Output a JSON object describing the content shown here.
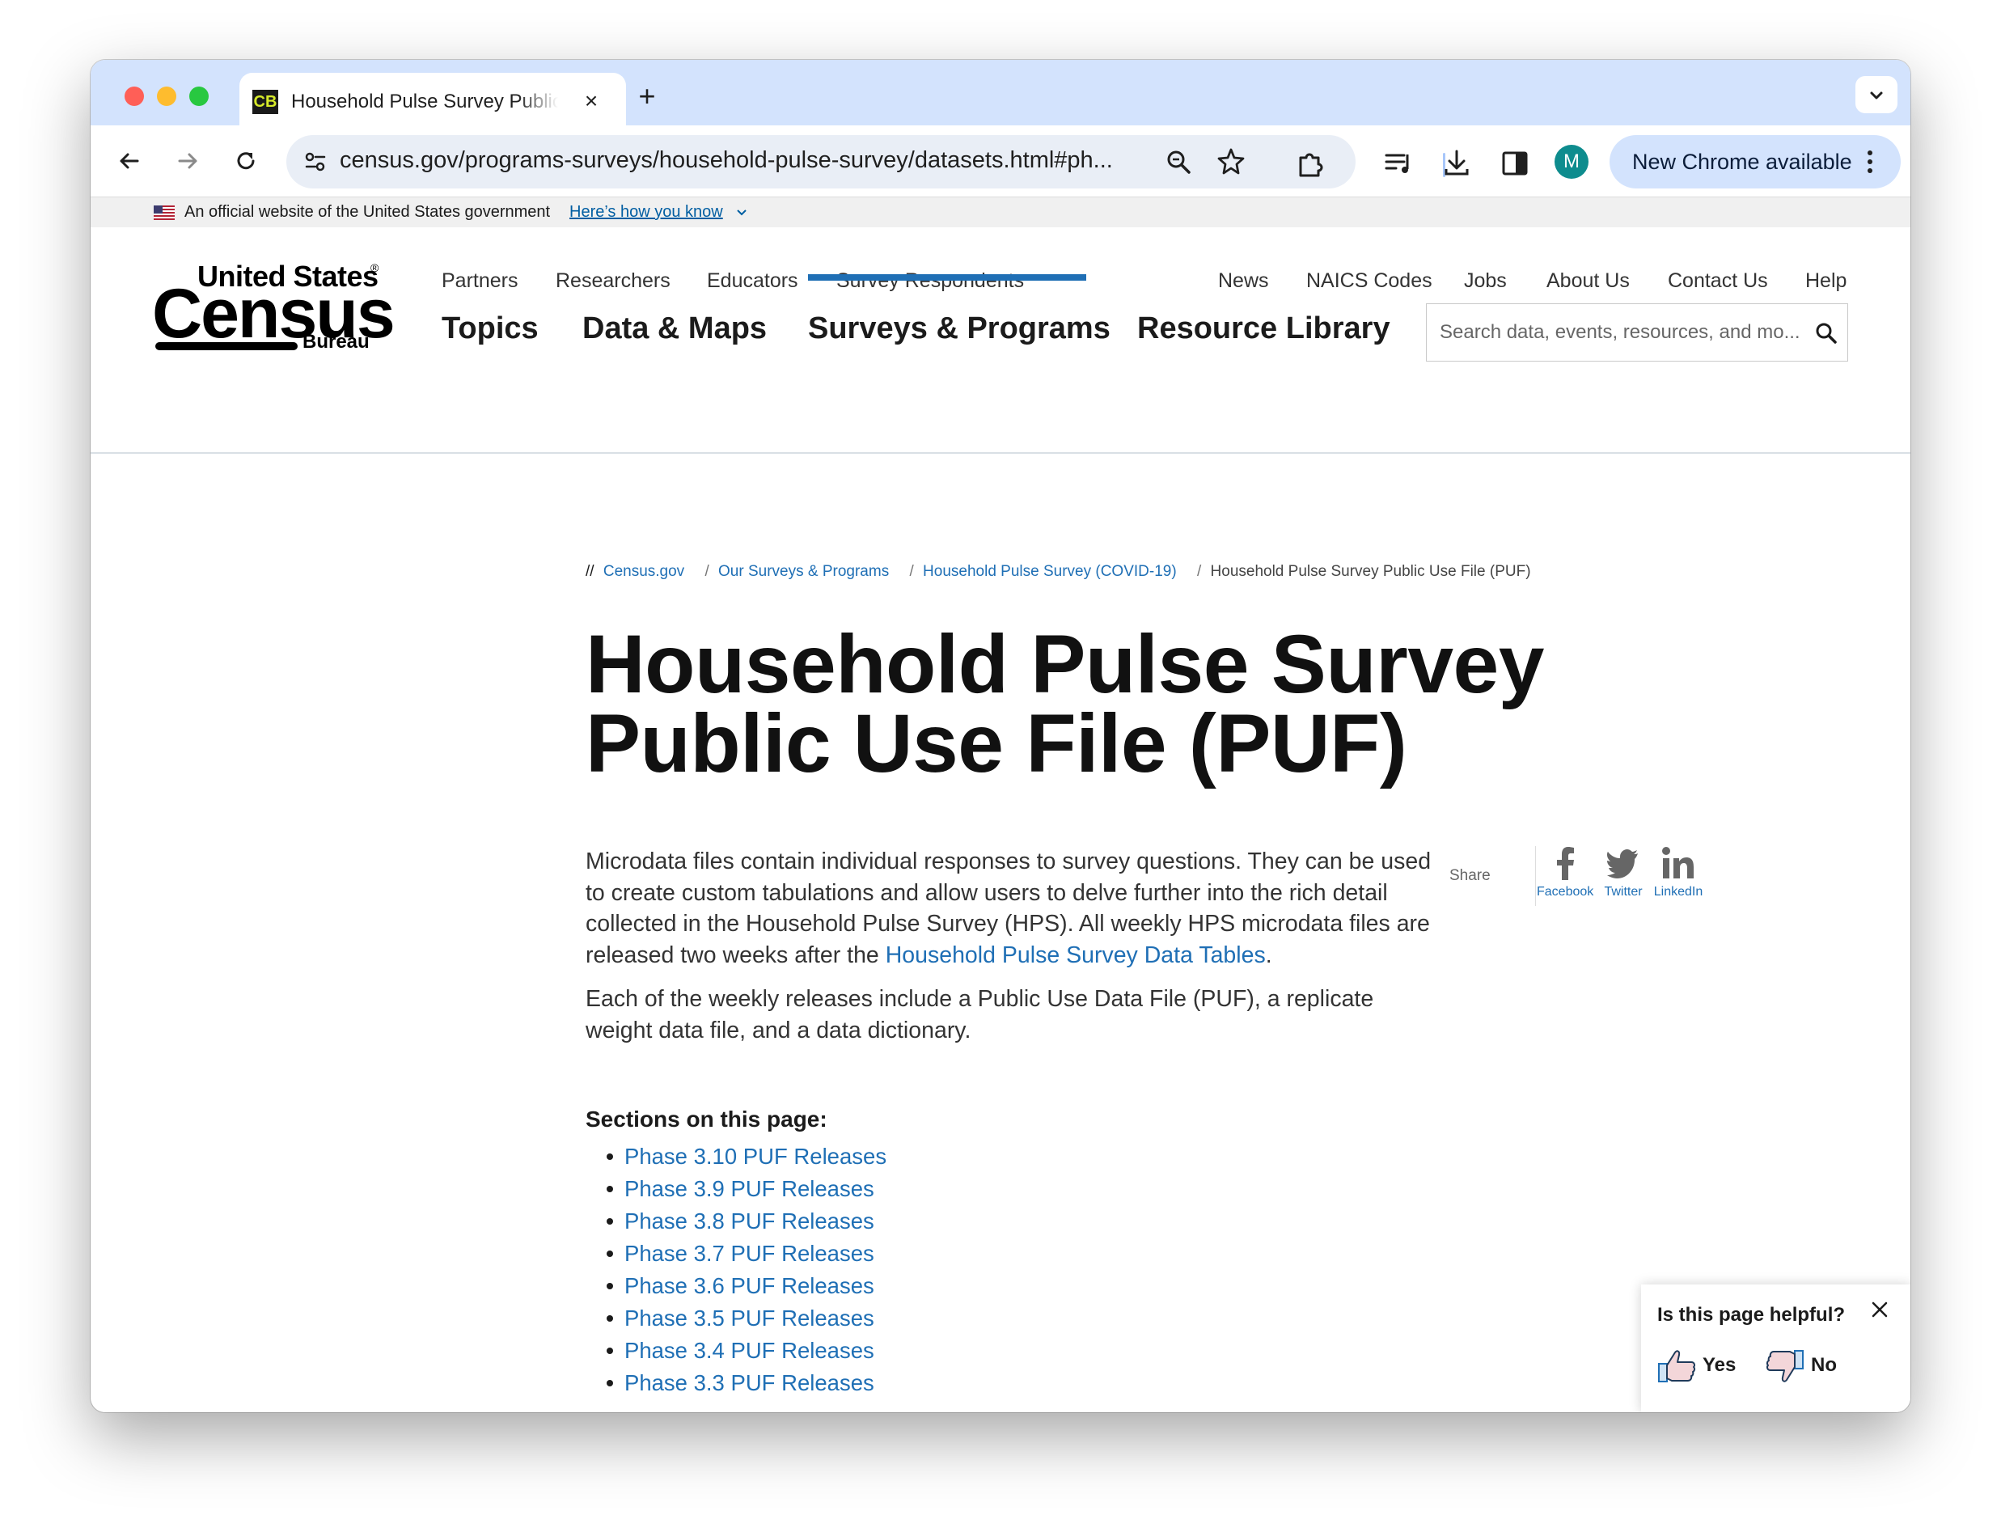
{
  "browser": {
    "tab_title": "Household Pulse Survey Public Use File (PUF)",
    "tab_favicon_text": "CB",
    "url": "census.gov/programs-surveys/household-pulse-survey/datasets.html#ph...",
    "profile_initial": "M",
    "update_button_label": "New Chrome available"
  },
  "gov_banner": {
    "text": "An official website of the United States government",
    "link": "Here’s how you know"
  },
  "logo": {
    "line1": "United States",
    "line2": "Census",
    "line3": "Bureau",
    "reg": "®"
  },
  "utility_nav": {
    "left": [
      "Partners",
      "Researchers",
      "Educators",
      "Survey Respondents"
    ],
    "right": [
      "News",
      "NAICS Codes",
      "Jobs",
      "About Us",
      "Contact Us",
      "Help"
    ]
  },
  "main_nav": {
    "items": [
      "Topics",
      "Data & Maps",
      "Surveys & Programs",
      "Resource Library"
    ],
    "active": "Surveys & Programs"
  },
  "search": {
    "placeholder": "Search data, events, resources, and mo..."
  },
  "breadcrumb": {
    "prefix": "//",
    "links": [
      "Census.gov",
      "Our Surveys & Programs",
      "Household Pulse Survey (COVID-19)"
    ],
    "current": "Household Pulse Survey Public Use File (PUF)"
  },
  "page": {
    "title": "Household Pulse Survey Public Use File (PUF)",
    "intro_before_link": "Microdata files contain individual responses to survey questions. They can be used to create custom tabulations and allow users to delve further into the rich detail collected in the Household Pulse Survey (HPS). All weekly HPS microdata files are released two weeks after the ",
    "intro_link": "Household Pulse Survey Data Tables",
    "intro_after_link": ".",
    "paragraph2": "Each of the weekly releases include a Public Use Data File (PUF), a replicate weight data file, and a data dictionary.",
    "sections_heading": "Sections on this page:",
    "sections": [
      "Phase 3.10 PUF Releases",
      "Phase 3.9 PUF Releases",
      "Phase 3.8 PUF Releases",
      "Phase 3.7 PUF Releases",
      "Phase 3.6 PUF Releases",
      "Phase 3.5 PUF Releases",
      "Phase 3.4 PUF Releases",
      "Phase 3.3 PUF Releases"
    ]
  },
  "share": {
    "label": "Share",
    "items": [
      {
        "label": "Facebook",
        "icon": "facebook-icon"
      },
      {
        "label": "Twitter",
        "icon": "twitter-icon"
      },
      {
        "label": "LinkedIn",
        "icon": "linkedin-icon"
      }
    ]
  },
  "feedback": {
    "question": "Is this page helpful?",
    "yes": "Yes",
    "no": "No"
  },
  "colors": {
    "link": "#1f6fb5",
    "active_nav_underline": "#1f6fb5",
    "tabstrip": "#d3e3fd",
    "omnibox": "#e9eef6"
  }
}
